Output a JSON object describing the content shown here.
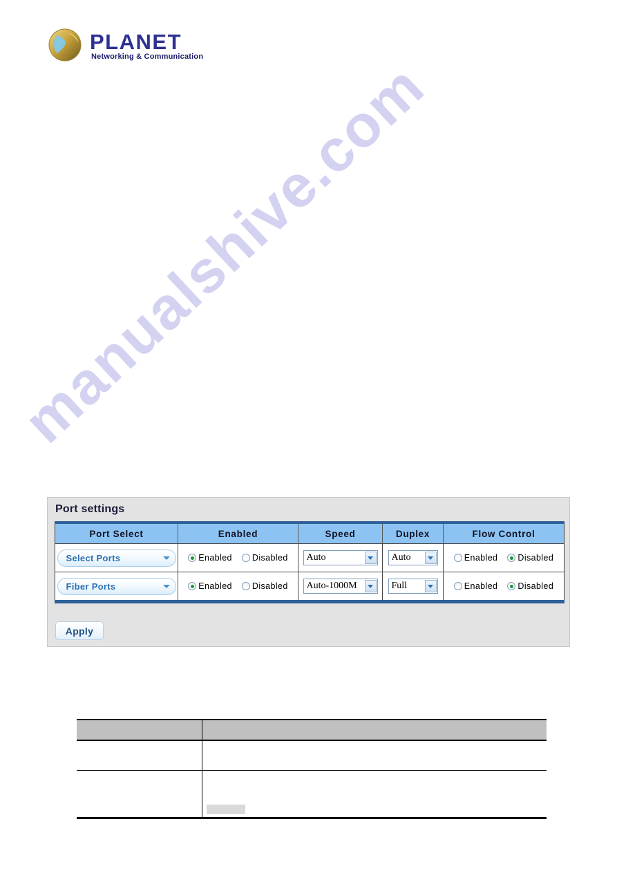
{
  "logo": {
    "brand": "PLANET",
    "tagline": "Networking & Communication",
    "icon": "planet-globe-icon",
    "brand_color": "#2e3192",
    "tagline_color": "#1b1b6a"
  },
  "watermark": {
    "text": "manualshive.com",
    "color": "#b9b7ea"
  },
  "panel": {
    "title": "Port settings",
    "accent_color": "#2f6098",
    "header_color": "#8cc3f2",
    "apply_label": "Apply"
  },
  "table": {
    "columns": [
      {
        "label": "Port Select"
      },
      {
        "label": "Enabled"
      },
      {
        "label": "Speed"
      },
      {
        "label": "Duplex"
      },
      {
        "label": "Flow Control"
      }
    ],
    "rows": [
      {
        "port_select": "Select Ports",
        "enabled": {
          "option_on": "Enabled",
          "option_off": "Disabled",
          "selected": "Enabled"
        },
        "speed": "Auto",
        "duplex": "Auto",
        "flow_control": {
          "option_on": "Enabled",
          "option_off": "Disabled",
          "selected": "Disabled"
        }
      },
      {
        "port_select": "Fiber Ports",
        "enabled": {
          "option_on": "Enabled",
          "option_off": "Disabled",
          "selected": "Enabled"
        },
        "speed": "Auto-1000M",
        "duplex": "Full",
        "flow_control": {
          "option_on": "Enabled",
          "option_off": "Disabled",
          "selected": "Disabled"
        }
      }
    ]
  },
  "description_table": {
    "header": [
      "",
      ""
    ],
    "rows": [
      {
        "cells": [
          "",
          ""
        ]
      },
      {
        "cells": [
          "",
          ""
        ]
      }
    ]
  }
}
